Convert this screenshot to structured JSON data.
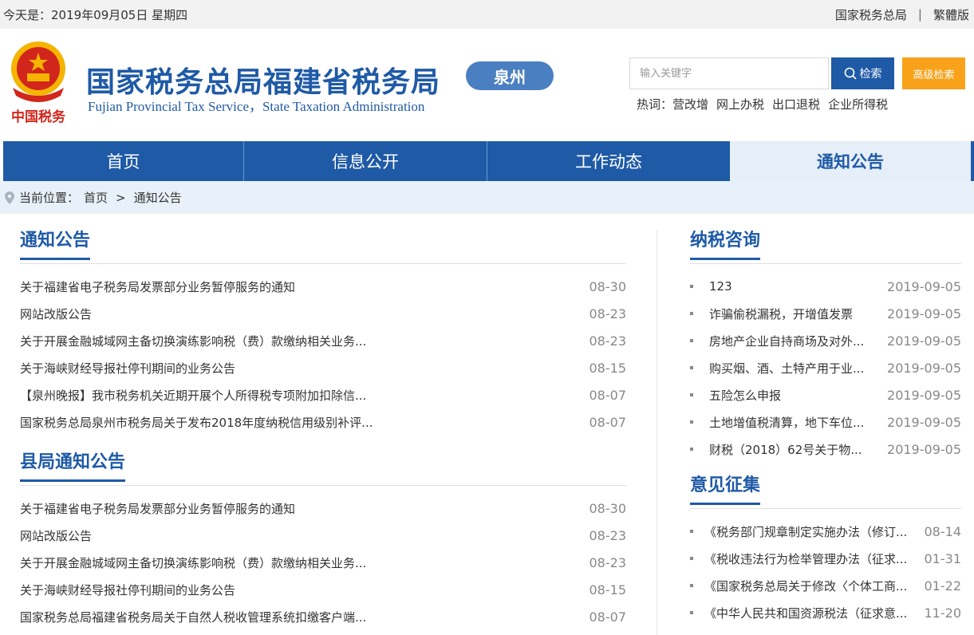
{
  "topbar": {
    "date_text": "今天是：2019年09月05日 星期四",
    "link1": "国家税务总局",
    "separator": "|",
    "link2": "繁體版"
  },
  "header": {
    "emblem_text": "中国税务",
    "title_zh": "国家税务总局福建省税务局",
    "title_en": "Fujian Provincial Tax Service，State Taxation Administration",
    "city": "泉州",
    "search_placeholder": "输入关键字",
    "search_label": "检索",
    "advanced_search_label": "高级检索",
    "hotwords_label": "热词：",
    "hotwords": [
      "营改增",
      "网上办税",
      "出口退税",
      "企业所得税"
    ]
  },
  "nav": {
    "items": [
      {
        "label": "首页"
      },
      {
        "label": "信息公开"
      },
      {
        "label": "工作动态"
      },
      {
        "label": "通知公告"
      }
    ]
  },
  "breadcrumb": {
    "prefix": "当前位置：",
    "home": "首页",
    "sep": ">",
    "current": "通知公告"
  },
  "notices": {
    "title": "通知公告",
    "items": [
      {
        "title": "关于福建省电子税务局发票部分业务暂停服务的通知",
        "date": "08-30"
      },
      {
        "title": "网站改版公告",
        "date": "08-23"
      },
      {
        "title": "关于开展金融城域网主备切换演练影响税（费）款缴纳相关业务...",
        "date": "08-23"
      },
      {
        "title": "关于海峡财经导报社停刊期间的业务公告",
        "date": "08-15"
      },
      {
        "title": "【泉州晚报】我市税务机关近期开展个人所得税专项附加扣除信...",
        "date": "08-07"
      },
      {
        "title": "国家税务总局泉州市税务局关于发布2018年度纳税信用级别补评...",
        "date": "08-07"
      }
    ]
  },
  "county_notices": {
    "title": "县局通知公告",
    "items": [
      {
        "title": "关于福建省电子税务局发票部分业务暂停服务的通知",
        "date": "08-30"
      },
      {
        "title": "网站改版公告",
        "date": "08-23"
      },
      {
        "title": "关于开展金融城域网主备切换演练影响税（费）款缴纳相关业务...",
        "date": "08-23"
      },
      {
        "title": "关于海峡财经导报社停刊期间的业务公告",
        "date": "08-15"
      },
      {
        "title": "国家税务总局福建省税务局关于自然人税收管理系统扣缴客户端...",
        "date": "08-07"
      }
    ]
  },
  "consult": {
    "title": "纳税咨询",
    "items": [
      {
        "title": "123",
        "date": "2019-09-05"
      },
      {
        "title": "诈骗偷税漏税，开增值发票",
        "date": "2019-09-05"
      },
      {
        "title": "房地产企业自持商场及对外...",
        "date": "2019-09-05"
      },
      {
        "title": "购买烟、酒、土特产用于业...",
        "date": "2019-09-05"
      },
      {
        "title": "五险怎么申报",
        "date": "2019-09-05"
      },
      {
        "title": "土地增值税清算，地下车位...",
        "date": "2019-09-05"
      },
      {
        "title": "财税（2018）62号关于物...",
        "date": "2019-09-05"
      }
    ]
  },
  "opinions": {
    "title": "意见征集",
    "items": [
      {
        "title": "《税务部门规章制定实施办法（修订...",
        "date": "08-14"
      },
      {
        "title": "《税收违法行为检举管理办法（征求...",
        "date": "01-31"
      },
      {
        "title": "《国家税务总局关于修改〈个体工商...",
        "date": "01-22"
      },
      {
        "title": "《中华人民共和国资源税法（征求意...",
        "date": "11-20"
      }
    ]
  },
  "colors": {
    "brand_blue": "#1f5aa6",
    "accent_orange": "#f7a21a",
    "badge_blue": "#4a7fc1",
    "emblem_red": "#d2261c",
    "emblem_gold": "#f4b400"
  }
}
